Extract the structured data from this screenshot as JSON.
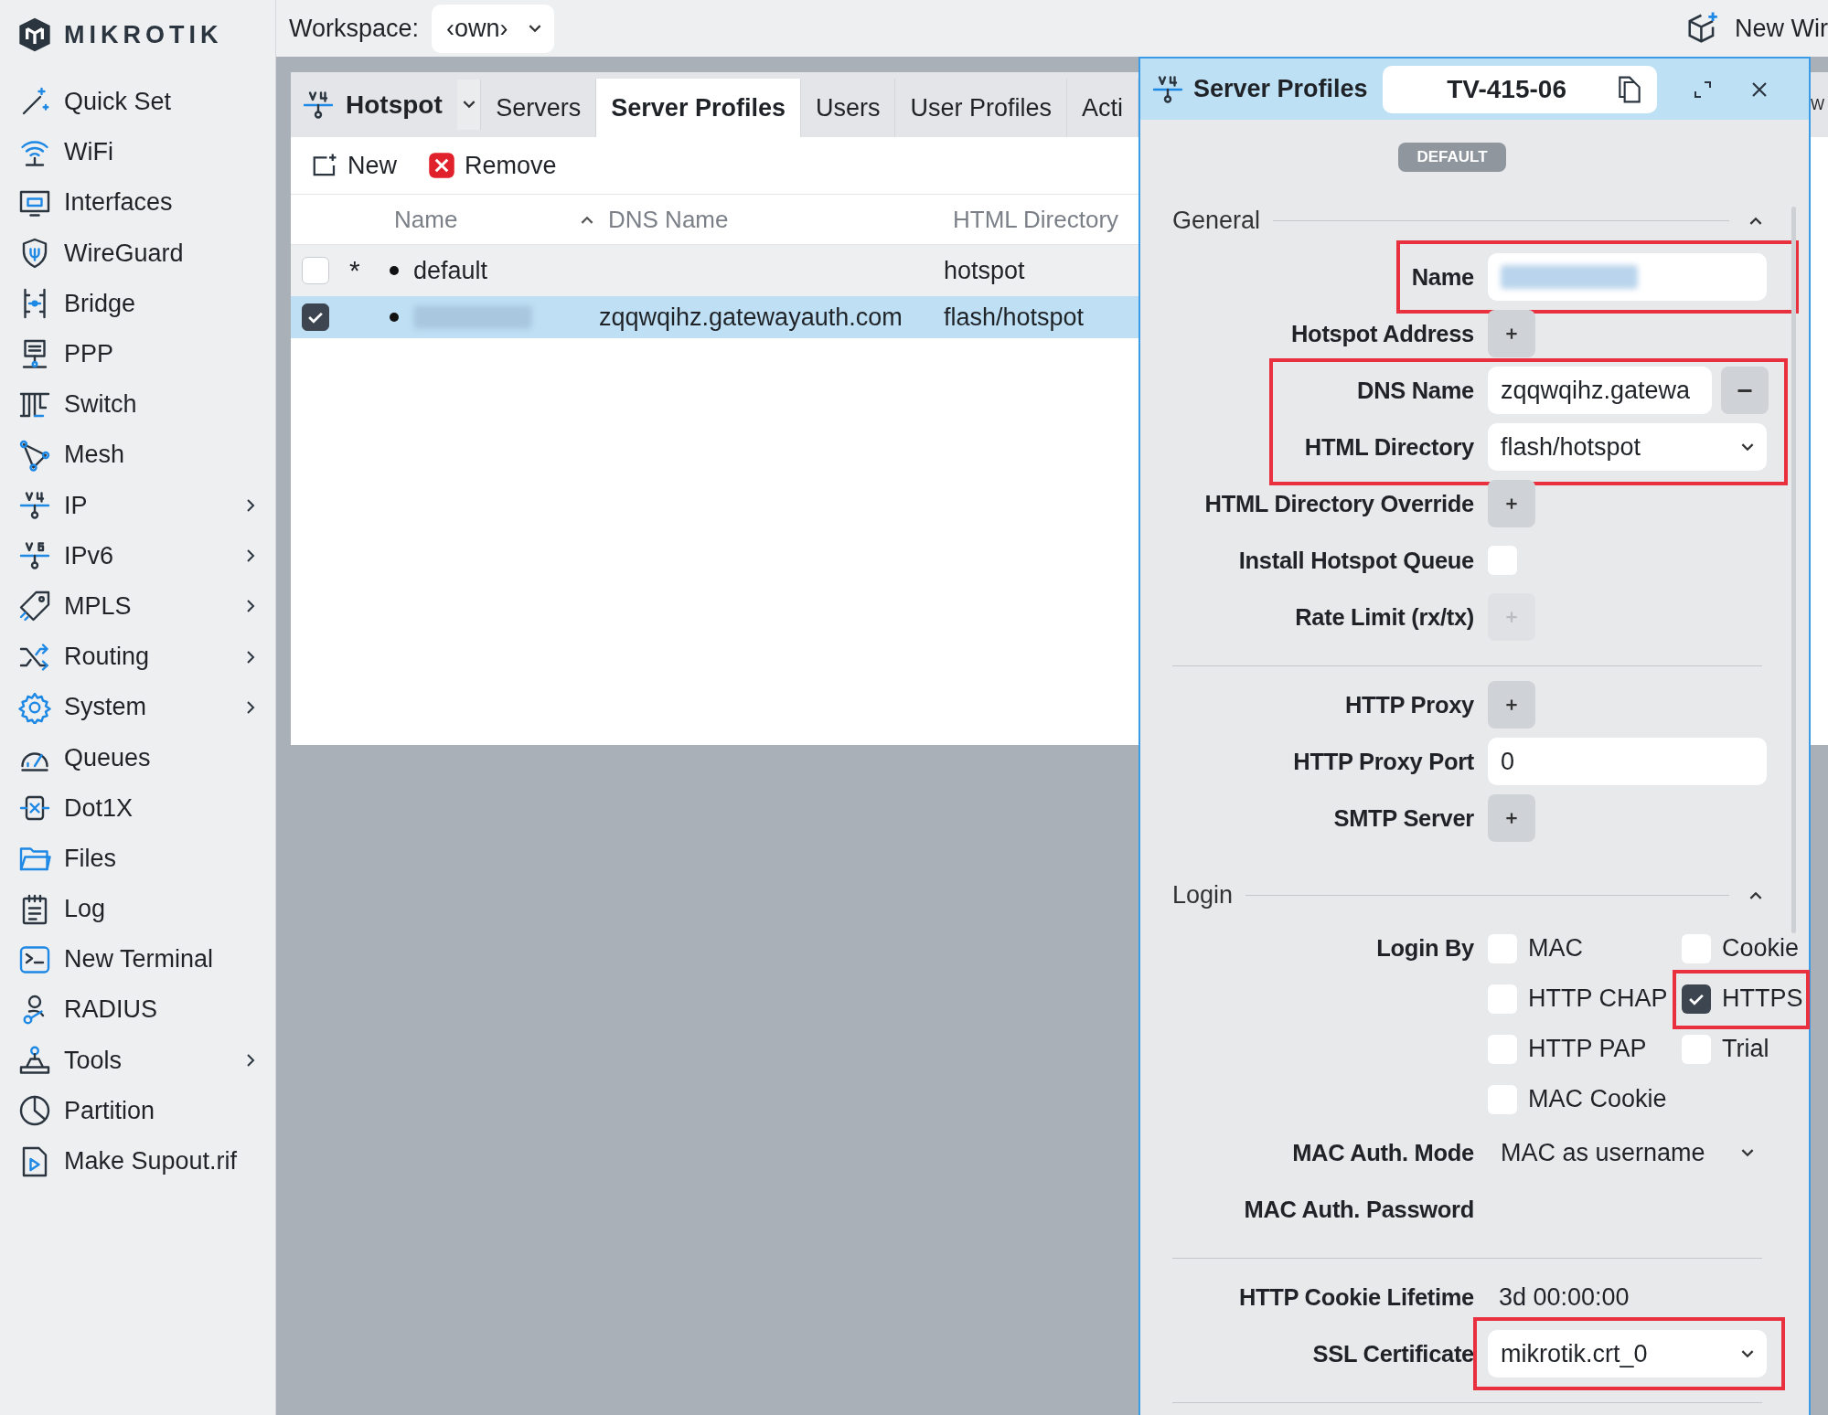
{
  "brand": "MIKROTIK",
  "sidebar": {
    "items": [
      {
        "label": "Quick Set",
        "has_submenu": false
      },
      {
        "label": "WiFi",
        "has_submenu": false
      },
      {
        "label": "Interfaces",
        "has_submenu": false
      },
      {
        "label": "WireGuard",
        "has_submenu": false
      },
      {
        "label": "Bridge",
        "has_submenu": false
      },
      {
        "label": "PPP",
        "has_submenu": false
      },
      {
        "label": "Switch",
        "has_submenu": false
      },
      {
        "label": "Mesh",
        "has_submenu": false
      },
      {
        "label": "IP",
        "has_submenu": true
      },
      {
        "label": "IPv6",
        "has_submenu": true
      },
      {
        "label": "MPLS",
        "has_submenu": true
      },
      {
        "label": "Routing",
        "has_submenu": true
      },
      {
        "label": "System",
        "has_submenu": true
      },
      {
        "label": "Queues",
        "has_submenu": false
      },
      {
        "label": "Dot1X",
        "has_submenu": false
      },
      {
        "label": "Files",
        "has_submenu": false
      },
      {
        "label": "Log",
        "has_submenu": false
      },
      {
        "label": "New Terminal",
        "has_submenu": false
      },
      {
        "label": "RADIUS",
        "has_submenu": false
      },
      {
        "label": "Tools",
        "has_submenu": true
      },
      {
        "label": "Partition",
        "has_submenu": false
      },
      {
        "label": "Make Supout.rif",
        "has_submenu": false
      }
    ]
  },
  "topbar": {
    "workspace_label": "Workspace:",
    "workspace_value": "‹own›",
    "new_window": "New Wir"
  },
  "panel": {
    "title": "Hotspot",
    "tabs": [
      {
        "label": "Servers",
        "selected": false
      },
      {
        "label": "Server Profiles",
        "selected": true
      },
      {
        "label": "Users",
        "selected": false
      },
      {
        "label": "User Profiles",
        "selected": false
      },
      {
        "label": "Acti",
        "selected": false
      }
    ],
    "edge_tab": "W",
    "toolbar": {
      "new": "New",
      "remove": "Remove"
    },
    "columns": [
      "Name",
      "DNS Name",
      "HTML Directory"
    ],
    "rows": [
      {
        "checked": false,
        "selected": false,
        "marker": "*",
        "name": "default",
        "blurred": false,
        "dns_name": "",
        "html_directory": "hotspot"
      },
      {
        "checked": true,
        "selected": true,
        "blurred": true,
        "dns_name": "zqqwqihz.gatewayauth.com",
        "html_directory": "flash/hotspot"
      }
    ]
  },
  "dialog": {
    "title": "Server Profiles",
    "record": "TV-415-06",
    "badge": "DEFAULT",
    "sections": [
      {
        "title": "General",
        "expanded": true,
        "groups": [
          [
            {
              "label": "Name",
              "kind": "field",
              "blurred": true,
              "highlighted": true
            },
            {
              "label": "Hotspot Address",
              "kind": "add",
              "disabled": false,
              "highlighted": false
            },
            {
              "label": "DNS Name",
              "kind": "field_remove",
              "value": "zqqwqihz.gatewa",
              "highlighted": true
            },
            {
              "label": "HTML Directory",
              "kind": "select",
              "value": "flash/hotspot",
              "highlighted": true
            },
            {
              "label": "HTML Directory Override",
              "kind": "add",
              "disabled": false,
              "highlighted": false
            },
            {
              "label": "Install Hotspot Queue",
              "kind": "checkbox",
              "checked": false,
              "highlighted": false
            },
            {
              "label": "Rate Limit (rx/tx)",
              "kind": "add",
              "disabled": true,
              "highlighted": false
            }
          ],
          [
            {
              "label": "HTTP Proxy",
              "kind": "add",
              "disabled": false,
              "highlighted": false
            },
            {
              "label": "HTTP Proxy Port",
              "kind": "field",
              "value": "0",
              "blurred": false,
              "highlighted": false
            },
            {
              "label": "SMTP Server",
              "kind": "add",
              "disabled": false,
              "highlighted": false
            }
          ]
        ]
      },
      {
        "title": "Login",
        "expanded": true,
        "groups": [
          [
            {
              "label": "Login By",
              "kind": "checks",
              "highlighted": false,
              "options": [
                {
                  "label": "MAC",
                  "checked": false,
                  "highlighted": false
                },
                {
                  "label": "Cookie",
                  "checked": false,
                  "highlighted": false
                },
                {
                  "label": "HTTP CHAP",
                  "checked": false,
                  "highlighted": false
                },
                {
                  "label": "HTTPS",
                  "checked": true,
                  "highlighted": true
                },
                {
                  "label": "HTTP PAP",
                  "checked": false,
                  "highlighted": false
                },
                {
                  "label": "Trial",
                  "checked": false,
                  "highlighted": false
                },
                {
                  "label": "MAC Cookie",
                  "checked": false,
                  "highlighted": false
                }
              ]
            },
            {
              "label": "MAC Auth. Mode",
              "kind": "plain_select",
              "value": "MAC as username",
              "highlighted": false
            },
            {
              "label": "MAC Auth. Password",
              "kind": "empty",
              "highlighted": false
            }
          ],
          [
            {
              "label": "HTTP Cookie Lifetime",
              "kind": "text",
              "value": "3d 00:00:00",
              "highlighted": false
            },
            {
              "label": "SSL Certificate",
              "kind": "select",
              "value": "mikrotik.crt_0",
              "highlighted": false,
              "value_highlighted": true
            }
          ]
        ]
      }
    ]
  }
}
